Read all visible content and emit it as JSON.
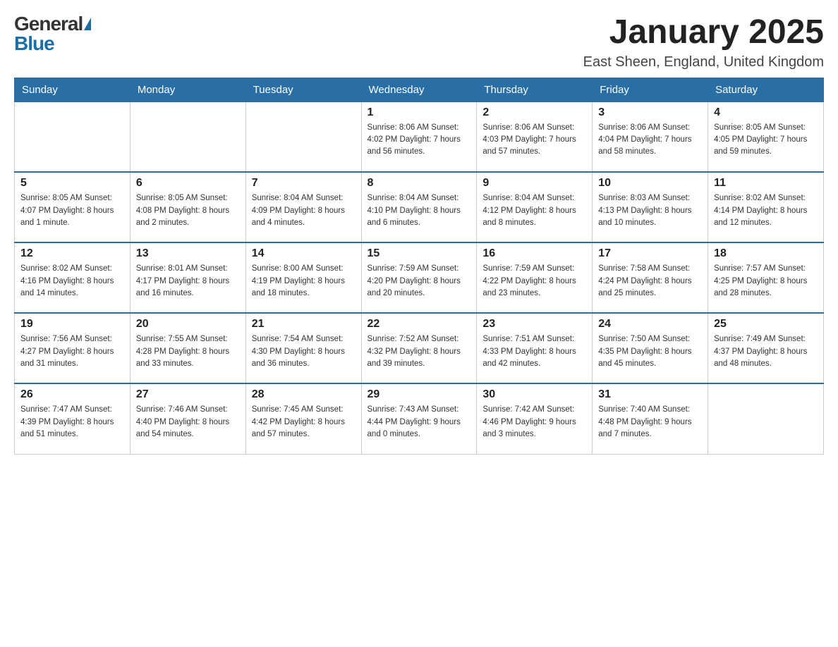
{
  "header": {
    "logo_general": "General",
    "logo_blue": "Blue",
    "month_title": "January 2025",
    "location": "East Sheen, England, United Kingdom"
  },
  "days_of_week": [
    "Sunday",
    "Monday",
    "Tuesday",
    "Wednesday",
    "Thursday",
    "Friday",
    "Saturday"
  ],
  "weeks": [
    [
      {
        "day": "",
        "info": ""
      },
      {
        "day": "",
        "info": ""
      },
      {
        "day": "",
        "info": ""
      },
      {
        "day": "1",
        "info": "Sunrise: 8:06 AM\nSunset: 4:02 PM\nDaylight: 7 hours\nand 56 minutes."
      },
      {
        "day": "2",
        "info": "Sunrise: 8:06 AM\nSunset: 4:03 PM\nDaylight: 7 hours\nand 57 minutes."
      },
      {
        "day": "3",
        "info": "Sunrise: 8:06 AM\nSunset: 4:04 PM\nDaylight: 7 hours\nand 58 minutes."
      },
      {
        "day": "4",
        "info": "Sunrise: 8:05 AM\nSunset: 4:05 PM\nDaylight: 7 hours\nand 59 minutes."
      }
    ],
    [
      {
        "day": "5",
        "info": "Sunrise: 8:05 AM\nSunset: 4:07 PM\nDaylight: 8 hours\nand 1 minute."
      },
      {
        "day": "6",
        "info": "Sunrise: 8:05 AM\nSunset: 4:08 PM\nDaylight: 8 hours\nand 2 minutes."
      },
      {
        "day": "7",
        "info": "Sunrise: 8:04 AM\nSunset: 4:09 PM\nDaylight: 8 hours\nand 4 minutes."
      },
      {
        "day": "8",
        "info": "Sunrise: 8:04 AM\nSunset: 4:10 PM\nDaylight: 8 hours\nand 6 minutes."
      },
      {
        "day": "9",
        "info": "Sunrise: 8:04 AM\nSunset: 4:12 PM\nDaylight: 8 hours\nand 8 minutes."
      },
      {
        "day": "10",
        "info": "Sunrise: 8:03 AM\nSunset: 4:13 PM\nDaylight: 8 hours\nand 10 minutes."
      },
      {
        "day": "11",
        "info": "Sunrise: 8:02 AM\nSunset: 4:14 PM\nDaylight: 8 hours\nand 12 minutes."
      }
    ],
    [
      {
        "day": "12",
        "info": "Sunrise: 8:02 AM\nSunset: 4:16 PM\nDaylight: 8 hours\nand 14 minutes."
      },
      {
        "day": "13",
        "info": "Sunrise: 8:01 AM\nSunset: 4:17 PM\nDaylight: 8 hours\nand 16 minutes."
      },
      {
        "day": "14",
        "info": "Sunrise: 8:00 AM\nSunset: 4:19 PM\nDaylight: 8 hours\nand 18 minutes."
      },
      {
        "day": "15",
        "info": "Sunrise: 7:59 AM\nSunset: 4:20 PM\nDaylight: 8 hours\nand 20 minutes."
      },
      {
        "day": "16",
        "info": "Sunrise: 7:59 AM\nSunset: 4:22 PM\nDaylight: 8 hours\nand 23 minutes."
      },
      {
        "day": "17",
        "info": "Sunrise: 7:58 AM\nSunset: 4:24 PM\nDaylight: 8 hours\nand 25 minutes."
      },
      {
        "day": "18",
        "info": "Sunrise: 7:57 AM\nSunset: 4:25 PM\nDaylight: 8 hours\nand 28 minutes."
      }
    ],
    [
      {
        "day": "19",
        "info": "Sunrise: 7:56 AM\nSunset: 4:27 PM\nDaylight: 8 hours\nand 31 minutes."
      },
      {
        "day": "20",
        "info": "Sunrise: 7:55 AM\nSunset: 4:28 PM\nDaylight: 8 hours\nand 33 minutes."
      },
      {
        "day": "21",
        "info": "Sunrise: 7:54 AM\nSunset: 4:30 PM\nDaylight: 8 hours\nand 36 minutes."
      },
      {
        "day": "22",
        "info": "Sunrise: 7:52 AM\nSunset: 4:32 PM\nDaylight: 8 hours\nand 39 minutes."
      },
      {
        "day": "23",
        "info": "Sunrise: 7:51 AM\nSunset: 4:33 PM\nDaylight: 8 hours\nand 42 minutes."
      },
      {
        "day": "24",
        "info": "Sunrise: 7:50 AM\nSunset: 4:35 PM\nDaylight: 8 hours\nand 45 minutes."
      },
      {
        "day": "25",
        "info": "Sunrise: 7:49 AM\nSunset: 4:37 PM\nDaylight: 8 hours\nand 48 minutes."
      }
    ],
    [
      {
        "day": "26",
        "info": "Sunrise: 7:47 AM\nSunset: 4:39 PM\nDaylight: 8 hours\nand 51 minutes."
      },
      {
        "day": "27",
        "info": "Sunrise: 7:46 AM\nSunset: 4:40 PM\nDaylight: 8 hours\nand 54 minutes."
      },
      {
        "day": "28",
        "info": "Sunrise: 7:45 AM\nSunset: 4:42 PM\nDaylight: 8 hours\nand 57 minutes."
      },
      {
        "day": "29",
        "info": "Sunrise: 7:43 AM\nSunset: 4:44 PM\nDaylight: 9 hours\nand 0 minutes."
      },
      {
        "day": "30",
        "info": "Sunrise: 7:42 AM\nSunset: 4:46 PM\nDaylight: 9 hours\nand 3 minutes."
      },
      {
        "day": "31",
        "info": "Sunrise: 7:40 AM\nSunset: 4:48 PM\nDaylight: 9 hours\nand 7 minutes."
      },
      {
        "day": "",
        "info": ""
      }
    ]
  ]
}
